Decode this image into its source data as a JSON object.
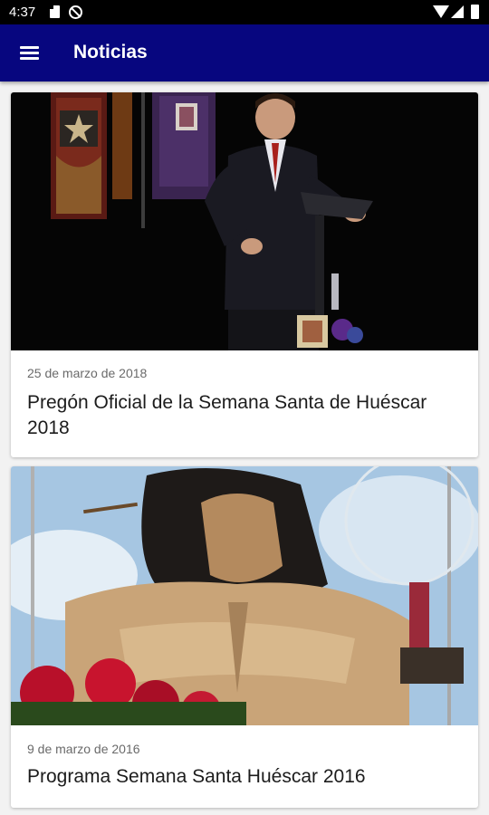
{
  "status_bar": {
    "time": "4:37"
  },
  "app_bar": {
    "title": "Noticias",
    "menu_icon": "hamburger-menu-icon"
  },
  "news": [
    {
      "date": "25 de marzo de 2018",
      "title": "Pregón Oficial de la Semana Santa de Huéscar 2018"
    },
    {
      "date": "9 de marzo de 2016",
      "title": "Programa Semana Santa Huéscar 2016"
    }
  ],
  "colors": {
    "app_bar": "#07067f",
    "background": "#f2f2f2",
    "status_bar": "#000000"
  }
}
